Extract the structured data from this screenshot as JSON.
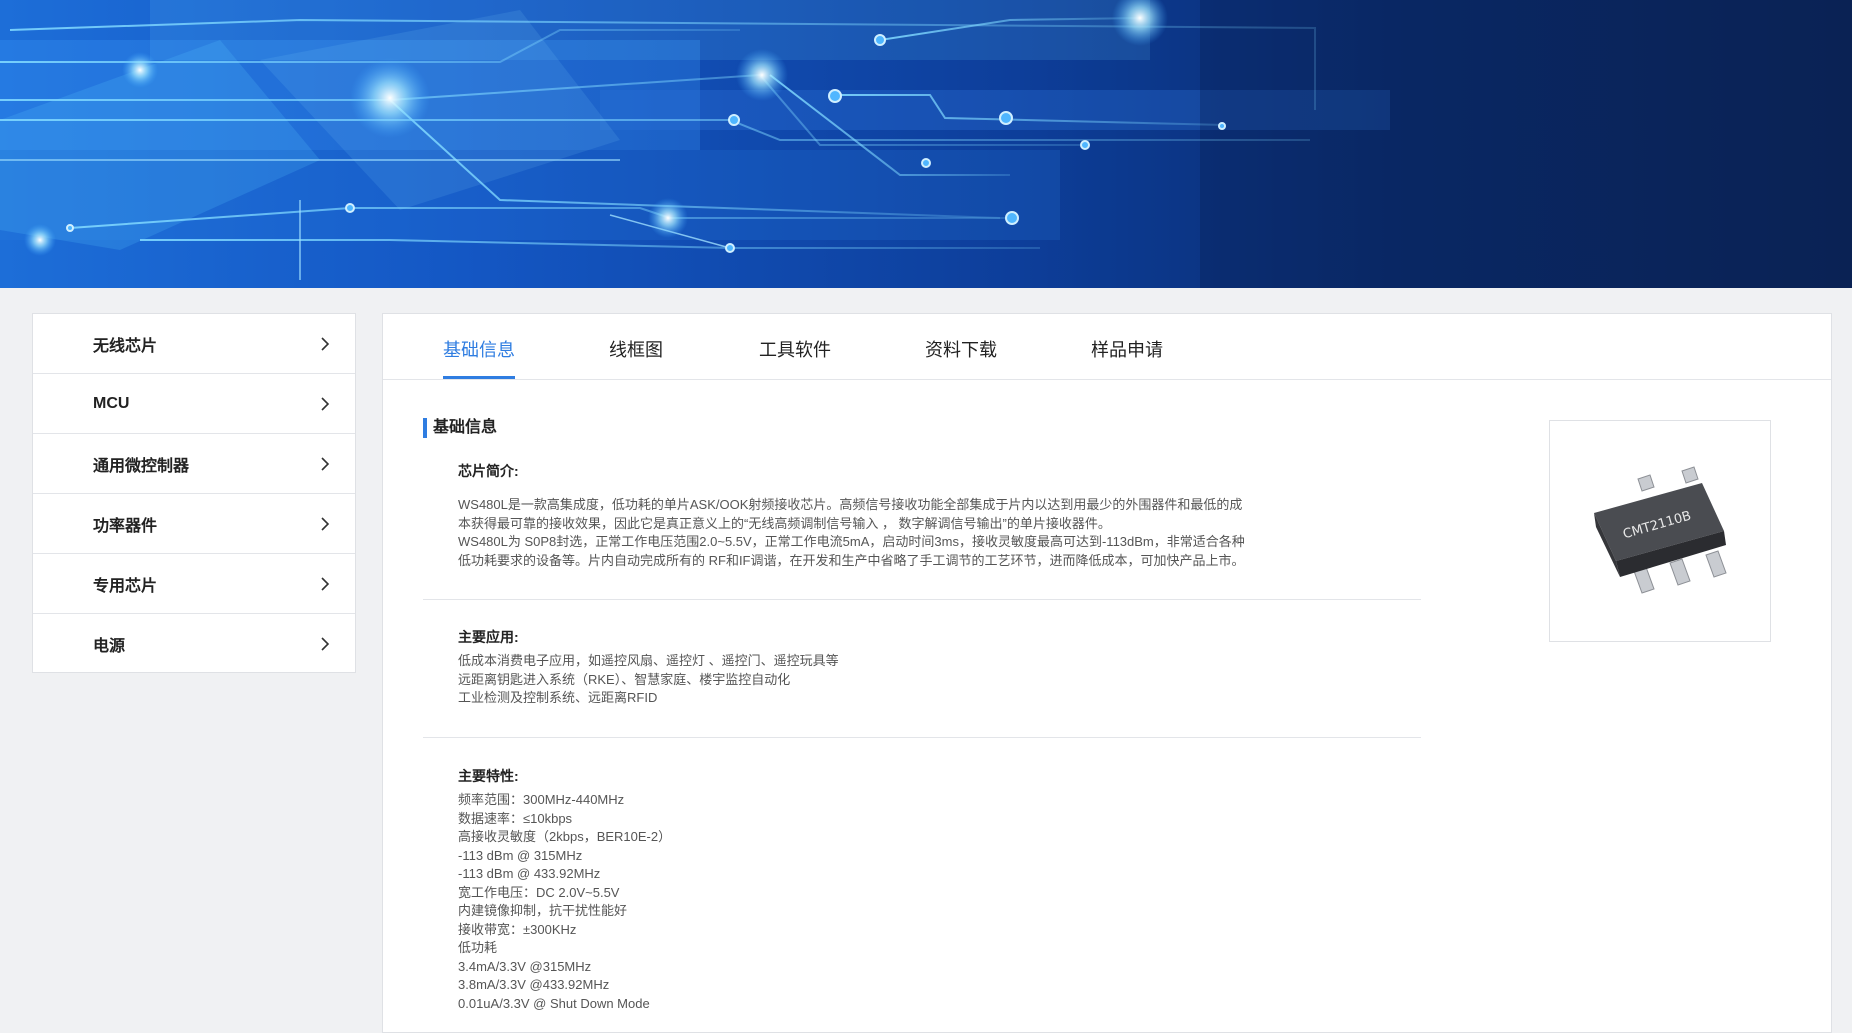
{
  "sidebar": {
    "items": [
      {
        "label": "无线芯片"
      },
      {
        "label": "MCU"
      },
      {
        "label": "通用微控制器"
      },
      {
        "label": "功率器件"
      },
      {
        "label": "专用芯片"
      },
      {
        "label": "电源"
      }
    ]
  },
  "tabs": [
    {
      "label": "基础信息",
      "active": true
    },
    {
      "label": "线框图"
    },
    {
      "label": "工具软件"
    },
    {
      "label": "资料下载"
    },
    {
      "label": "样品申请"
    }
  ],
  "content": {
    "section_title": "基础信息",
    "intro": {
      "title": "芯片简介:",
      "lines": [
        "WS480L是一款高集成度，低功耗的单片ASK/OOK射频接收芯片。高频信号接收功能全部集成于片内以达到用最少的外围器件和最低的成",
        "本获得最可靠的接收效果，因此它是真正意义上的“无线高频调制信号输入 ， 数字解调信号输出”的单片接收器件。",
        "WS480L为 S0P8封选，正常工作电压范围2.0~5.5V，正常工作电流5mA，启动时间3ms，接收灵敏度最高可达到-113dBm，非常适合各种",
        "低功耗要求的设备等。片内自动完成所有的 RF和IF调谐，在开发和生产中省略了手工调节的工艺环节，进而降低成本，可加快产品上市。"
      ]
    },
    "applications": {
      "title": "主要应用:",
      "lines": [
        "低成本消费电子应用，如遥控风扇、遥控灯 、遥控门、遥控玩具等",
        "远距离钥匙进入系统（RKE）、智慧家庭、楼宇监控自动化",
        "工业检测及控制系统、远距离RFID"
      ]
    },
    "features": {
      "title": "主要特性:",
      "lines": [
        "频率范围：300MHz-440MHz",
        "数据速率：≤10kbps",
        "高接收灵敏度（2kbps，BER10E-2）",
        "-113 dBm @ 315MHz",
        "-113 dBm @ 433.92MHz",
        "宽工作电压：DC 2.0V~5.5V",
        "内建镜像抑制，抗干扰性能好",
        "接收带宽：±300KHz",
        "低功耗",
        "3.4mA/3.3V @315MHz",
        "3.8mA/3.3V @433.92MHz",
        "0.01uA/3.3V @ Shut Down Mode"
      ]
    },
    "product_image_label": "CMT2110B"
  },
  "colors": {
    "accent": "#2f7de1",
    "banner_dark": "#0b2457",
    "banner_light": "#1d6ed8"
  }
}
